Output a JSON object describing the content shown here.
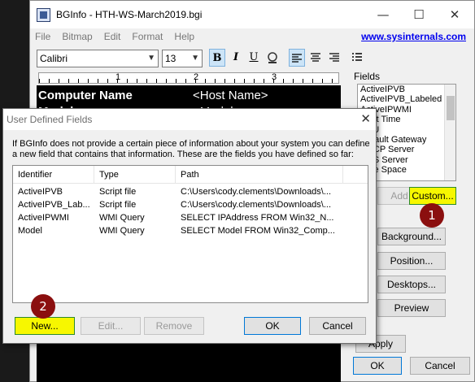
{
  "main_window": {
    "title": "BGInfo - HTH-WS-March2019.bgi",
    "controls": {
      "minimize": "—",
      "maximize": "☐",
      "close": "✕"
    },
    "menu": [
      "File",
      "Bitmap",
      "Edit",
      "Format",
      "Help"
    ],
    "link": "www.sysinternals.com",
    "toolbar": {
      "font": "Calibri",
      "size": "13",
      "bold": "B",
      "italic": "I",
      "underline": "U",
      "bullets_icon": "≡"
    },
    "ruler": [
      "1",
      "2",
      "3"
    ],
    "editor": {
      "label": "Computer Name",
      "value": "<Host Name>",
      "label2": "Model",
      "value2": "<Model>"
    },
    "fields_label": "Fields",
    "fields": [
      "ActiveIPVB",
      "ActiveIPVB_Labeled",
      "ActiveIPWMI",
      "Boot Time",
      "CPU",
      "Default Gateway",
      "DHCP Server",
      "DNS Server",
      "Free Space"
    ],
    "buttons": {
      "add": "Add",
      "custom": "Custom...",
      "background": "Background...",
      "position": "Position...",
      "desktops": "Desktops...",
      "preview": "Preview",
      "apply": "Apply",
      "ok": "OK",
      "cancel": "Cancel"
    }
  },
  "markers": {
    "one": "1",
    "two": "2"
  },
  "dialog": {
    "title": "User Defined Fields",
    "description": "If BGInfo does not provide a certain piece of information about your system you can define a new field that contains that information. These are the fields you have defined so far:",
    "columns": [
      "Identifier",
      "Type",
      "Path"
    ],
    "rows": [
      {
        "identifier": "ActiveIPVB",
        "type": "Script file",
        "path": "C:\\Users\\cody.clements\\Downloads\\..."
      },
      {
        "identifier": "ActiveIPVB_Lab...",
        "type": "Script file",
        "path": "C:\\Users\\cody.clements\\Downloads\\..."
      },
      {
        "identifier": "ActiveIPWMI",
        "type": "WMI Query",
        "path": "SELECT IPAddress FROM Win32_N..."
      },
      {
        "identifier": "Model",
        "type": "WMI Query",
        "path": "SELECT Model FROM Win32_Comp..."
      }
    ],
    "buttons": {
      "new": "New...",
      "edit": "Edit...",
      "remove": "Remove",
      "ok": "OK",
      "cancel": "Cancel"
    }
  },
  "colors": {
    "highlight": "#f7f700",
    "marker": "#8b0f0f",
    "link": "#0000ee"
  }
}
